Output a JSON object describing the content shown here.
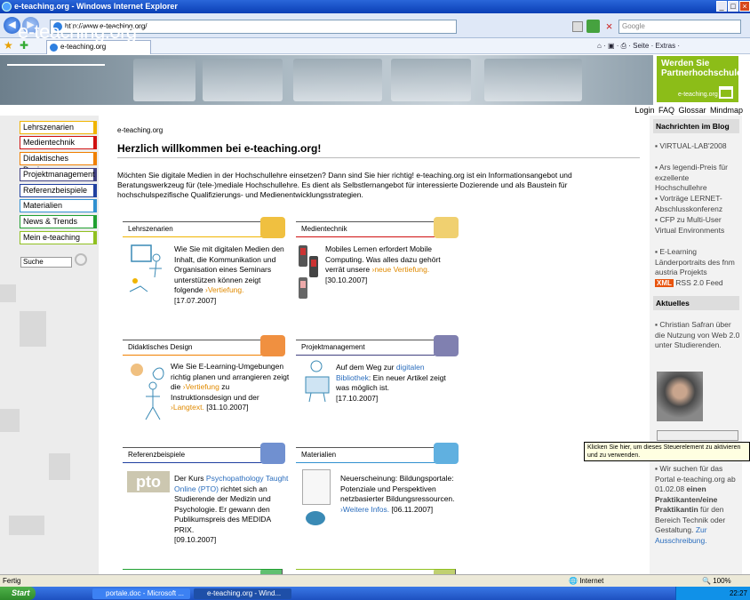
{
  "window": {
    "title": "e-teaching.org - Windows Internet Explorer",
    "min": "_",
    "max": "□",
    "close": "×"
  },
  "browser": {
    "back": "◀",
    "forward": "▶",
    "url": "http://www.e-teaching.org/",
    "search_placeholder": "Google",
    "tab_title": "e-teaching.org",
    "cmd": "⌂ · ▣ · ⎙ · Seite · Extras ·"
  },
  "site": {
    "logo": "e-teaching.org",
    "partner_title": "Werden Sie Partnerhochschule!",
    "partner_sub": "e-teaching.org"
  },
  "toplinks": "Login FAQ Glossar Mindmap",
  "nav": [
    "Lehrszenarien",
    "Medientechnik",
    "Didaktisches Design",
    "Projektmanagement",
    "Referenzbeispiele",
    "Materialien",
    "News & Trends",
    "Mein e-teaching"
  ],
  "search_label": "Suche",
  "breadcrumb": "e-teaching.org",
  "heading": "Herzlich willkommen bei e-teaching.org!",
  "intro": "Möchten Sie digitale Medien in der Hochschullehre einsetzen? Dann sind Sie hier richtig! e-teaching.org ist ein Informationsangebot und Beratungswerkzeug für (tele-)mediale Hochschullehre. Es dient als Selbstlernangebot für interessierte Dozierende und als Baustein für hochschulspezifische Qualifizierungs- und Medienentwicklungsstrategien.",
  "boxes": [
    {
      "title": "Lehrszenarien",
      "text": "Wie Sie mit digitalen Medien den Inhalt, die Kommunikation und Organisation eines Seminars unterstützen können zeigt folgende",
      "link": "Vertiefung.",
      "date": "[17.07.2007]",
      "color": "#f0b400"
    },
    {
      "title": "Medientechnik",
      "text": "Mobiles Lernen erfordert Mobile Computing. Was alles dazu gehört verrät unsere",
      "link": "neue Vertiefung.",
      "date": "[30.10.2007]",
      "color": "#d01010"
    },
    {
      "title": "Didaktisches Design",
      "text": "Wie Sie E-Learning-Umgebungen richtig planen und arrangieren zeigt die",
      "link": "Vertiefung",
      "text2": "zu Instruktionsdesign und der",
      "link2": "Langtext.",
      "date": "[31.10.2007]",
      "color": "#f08000"
    },
    {
      "title": "Projektmanagement",
      "text": "Auf dem Weg zur",
      "link": "digitalen Bibliothek",
      "text2": ": Ein neuer Artikel zeigt was möglich ist.",
      "date": "[17.10.2007]",
      "color": "#404080"
    },
    {
      "title": "Referenzbeispiele",
      "text": "Der Kurs",
      "link": "Psychopathology Taught Online (PTO)",
      "text2": "richtet sich an Studierende der Medizin und Psychologie. Er gewann den Publikumspreis des MEDIDA PRIX.",
      "date": "[09.10.2007]",
      "color": "#2040a0",
      "logo": "pto"
    },
    {
      "title": "Materialien",
      "text": "Neuerscheinung: Bildungsportale: Potenziale und Perspektiven netzbasierter Bildungsressourcen.",
      "link": "Weitere Infos.",
      "date": "[06.11.2007]",
      "color": "#3090d0"
    },
    {
      "title": "News & Trends",
      "color": "#20a030"
    },
    {
      "title": "Mein e-teaching",
      "color": "#90c020"
    }
  ],
  "blog": {
    "heading": "Nachrichten im Blog",
    "items": [
      "VIRTUAL-LAB'2008",
      "Ars legendi-Preis für exzellente Hochschullehre",
      "Vorträge LERNET-Abschlusskonferenz",
      "CFP zu Multi-User Virtual Environments",
      "E-Learning Länderportraits des fnm austria Projekts"
    ],
    "xml": "XML",
    "rss": "RSS 2.0 Feed"
  },
  "aktuelles": {
    "heading": "Aktuelles",
    "item": "Christian Safran über die Nutzung von Web 2.0 unter Studierenden."
  },
  "tooltip": "Klicken Sie hier, um dieses Steuerelement zu aktivieren und zu verwenden.",
  "job": {
    "text1": "Wir suchen für das Portal e-teaching.org ab 01.02.08",
    "bold1": "einen Praktikanten/eine Praktikantin",
    "text2": "für den Bereich Technik oder Gestaltung.",
    "link": "Zur Ausschreibung."
  },
  "status": {
    "left": "Fertig",
    "zone": "Internet",
    "zoom": "100%"
  },
  "taskbar": {
    "start": "Start",
    "task1": "portale.doc - Microsoft ...",
    "task2": "e-teaching.org - Wind...",
    "clock": "22:27"
  }
}
